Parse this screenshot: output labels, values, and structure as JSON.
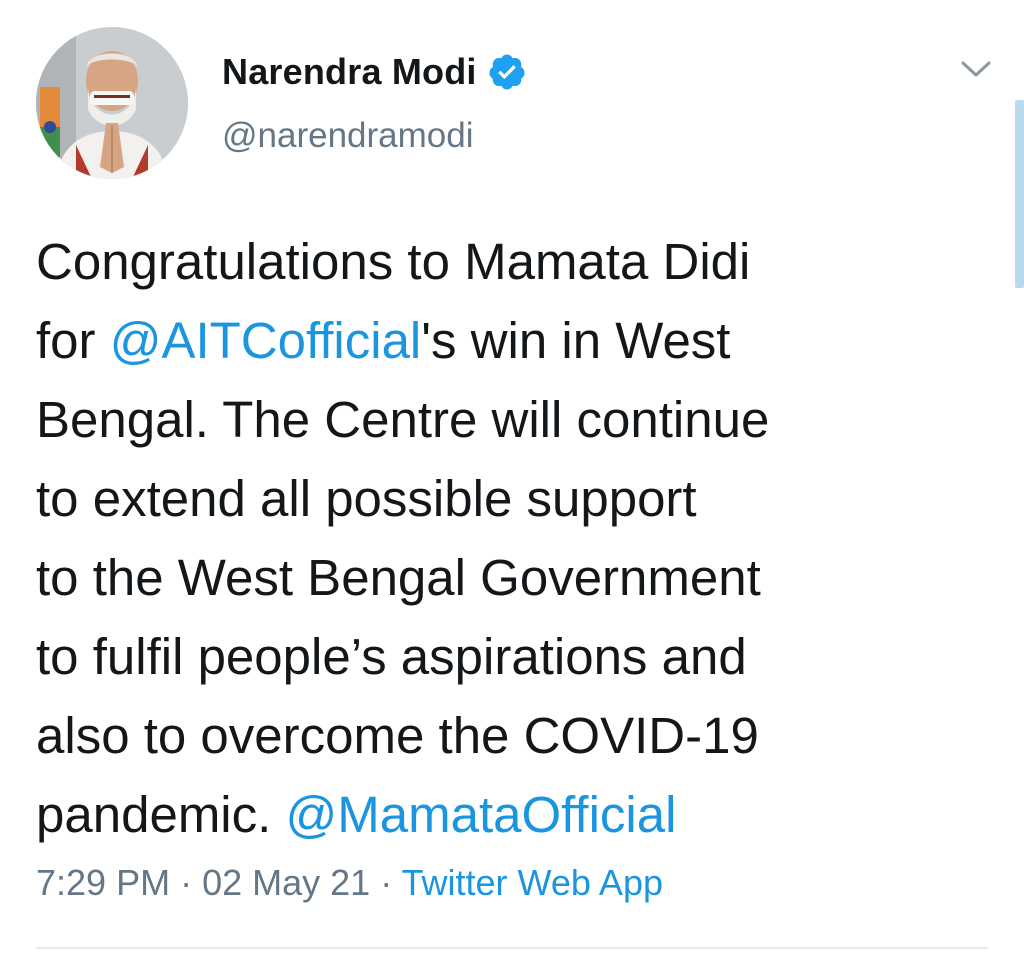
{
  "author": {
    "display_name": "Narendra Modi",
    "handle": "@narendramodi",
    "verified": true,
    "avatar_icon": "profile-photo-icon"
  },
  "tweet": {
    "line1": "Congratulations to Mamata Didi",
    "line2_prefix": "for ",
    "mention1": "@AITCofficial",
    "line2_suffix": "'s win in West",
    "line3": "Bengal. The Centre will continue",
    "line4": "to extend all possible support",
    "line5": "to the West Bengal Government",
    "line6": "to fulfil people’s aspirations and",
    "line7": "also to overcome the COVID-19",
    "line8_prefix": "pandemic. ",
    "mention2": "@MamataOfficial"
  },
  "meta": {
    "time": "7:29 PM",
    "separator": " · ",
    "date": "02 May 21",
    "separator2": " · ",
    "source": "Twitter Web App"
  },
  "icons": {
    "verified": "verified-badge-icon",
    "menu": "chevron-down-icon"
  },
  "colors": {
    "link": "#1b95e0",
    "secondary_text": "#657786",
    "primary_text": "#14171a",
    "verified": "#1da1f2"
  }
}
